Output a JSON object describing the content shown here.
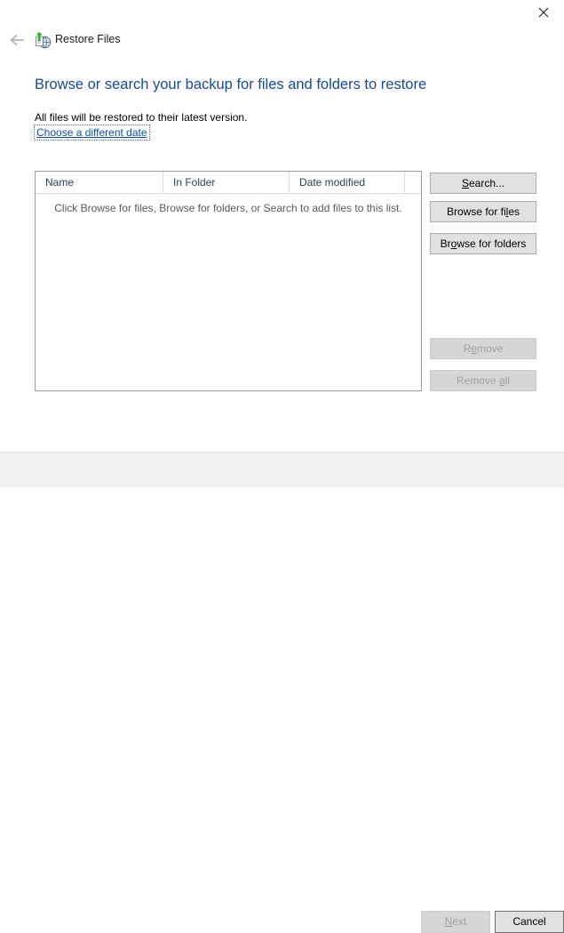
{
  "window": {
    "title": "Restore Files",
    "close_label": "×",
    "icons": {
      "close": "close-icon",
      "back": "back-arrow-icon",
      "app": "restore-files-icon"
    }
  },
  "content": {
    "heading": "Browse or search your backup for files and folders to restore",
    "subtext": "All files will be restored to their latest version.",
    "date_link": "Choose a different date"
  },
  "list": {
    "columns": [
      {
        "label": "Name"
      },
      {
        "label": "In Folder"
      },
      {
        "label": "Date modified"
      },
      {
        "label": ""
      }
    ],
    "empty_hint": "Click Browse for files, Browse for folders, or Search to add files to this list.",
    "rows": []
  },
  "side_buttons": [
    {
      "id": "search",
      "label": "Search...",
      "accel": "S",
      "enabled": true
    },
    {
      "id": "browse_files",
      "label": "Browse for files",
      "accel": "l",
      "enabled": true
    },
    {
      "id": "browse_folders",
      "label": "Browse for folders",
      "accel": "o",
      "enabled": true
    },
    {
      "id": "remove",
      "label": "Remove",
      "accel": "e",
      "enabled": false
    },
    {
      "id": "remove_all",
      "label": "Remove all",
      "accel": "a",
      "enabled": false
    }
  ],
  "footer": {
    "next_label": "Next",
    "next_enabled": false,
    "cancel_label": "Cancel",
    "cancel_enabled": true
  },
  "colors": {
    "heading": "#16499c",
    "link": "#0a4fb3",
    "column_header_text": "#2a3f55",
    "hint_text": "#595959",
    "footer_bg": "#f0f0f0",
    "button_face": "#e1e1e1",
    "button_border": "#adadad",
    "disabled_text": "#a0a0a0",
    "listbox_border": "#9a9a9a"
  }
}
